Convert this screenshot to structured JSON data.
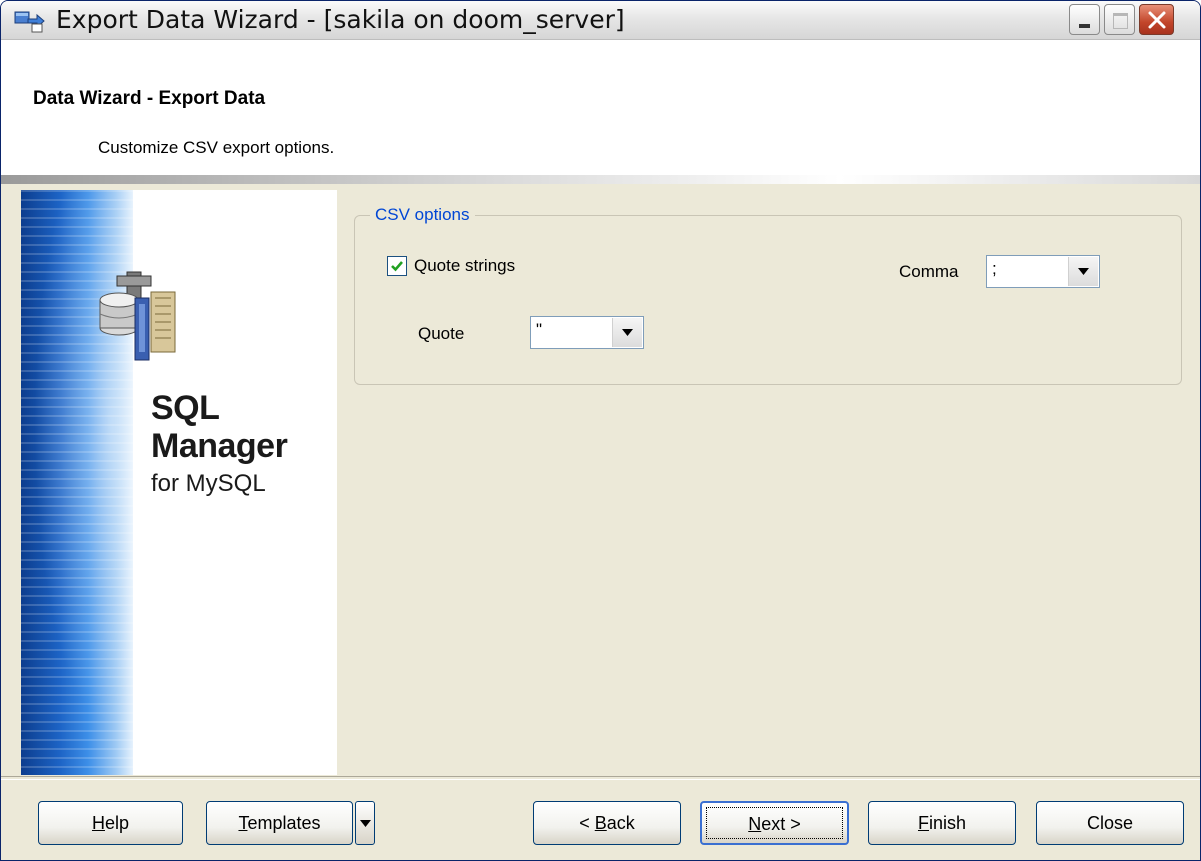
{
  "window": {
    "title": "Export Data Wizard - [sakila on doom_server]"
  },
  "header": {
    "title": "Data Wizard - Export Data",
    "subtitle": "Customize CSV export options."
  },
  "banner": {
    "line1": "SQL",
    "line2": "Manager",
    "line3": "for MySQL"
  },
  "csv_options": {
    "legend": "CSV options",
    "quote_strings": {
      "label": "Quote strings",
      "checked": true
    },
    "comma": {
      "label": "Comma",
      "value": ";"
    },
    "quote": {
      "label": "Quote",
      "value": "\""
    }
  },
  "buttons": {
    "help": {
      "hotkey": "H",
      "rest": "elp"
    },
    "templates": {
      "hotkey": "T",
      "rest": "emplates"
    },
    "back": {
      "prefix": "< ",
      "hotkey": "B",
      "rest": "ack"
    },
    "next": {
      "hotkey": "N",
      "rest": "ext >"
    },
    "finish": {
      "hotkey": "F",
      "rest": "inish"
    },
    "close": "Close"
  },
  "colors": {
    "legend": "#0046d5",
    "window_bg": "#ece9d8",
    "banner_blue": "#1d64c6"
  },
  "icons": {
    "app": "export-wizard-icon",
    "product": "database-tools-icon"
  }
}
